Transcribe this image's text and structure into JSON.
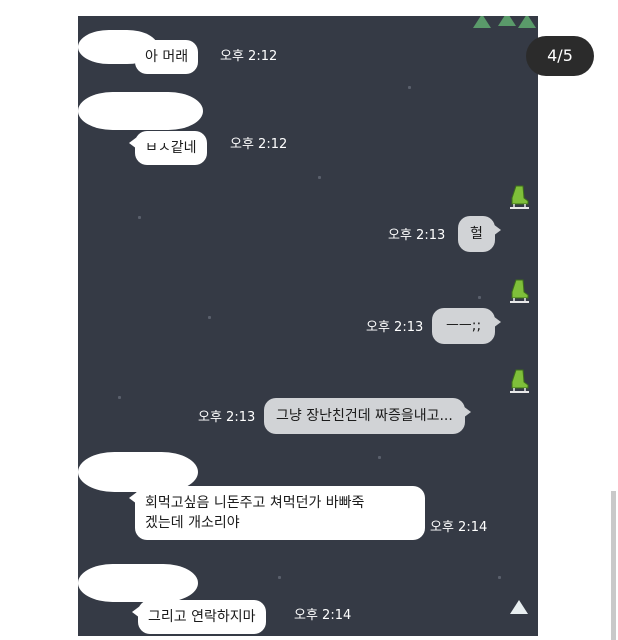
{
  "viewer": {
    "page_counter": "4/5"
  },
  "chat": {
    "background_color": "#353a45",
    "messages": [
      {
        "side": "received",
        "text": "아 머래",
        "time": "오후 2:12"
      },
      {
        "side": "received",
        "text": "ㅂㅅ같네",
        "time": "오후 2:12"
      },
      {
        "side": "sent",
        "text": "헐",
        "time": "오후 2:13"
      },
      {
        "side": "sent",
        "text": "ㅡㅡ;;",
        "time": "오후 2:13"
      },
      {
        "side": "sent",
        "text": "그냥 장난친건데 짜증을내고...",
        "time": "오후 2:13"
      },
      {
        "side": "received",
        "text": "회먹고싶음 니돈주고 쳐먹던가 바빠죽\n겠는데 개소리야",
        "time": "오후 2:14"
      },
      {
        "side": "received",
        "text": "그리고 연락하지마",
        "time": "오후 2:14"
      }
    ]
  },
  "icons": {
    "sent_sticker": "ice-skate-icon",
    "tree": "pine-tree-icon"
  }
}
